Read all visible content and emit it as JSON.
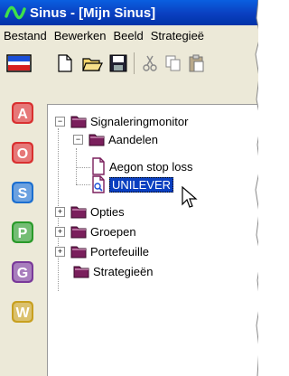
{
  "window": {
    "title": "Sinus - [Mijn Sinus]"
  },
  "menu": {
    "items": [
      "Bestand",
      "Bewerken",
      "Beeld",
      "Strategieë"
    ]
  },
  "toolbar": {
    "icons": [
      "layout-icon",
      "new-document-icon",
      "open-folder-icon",
      "save-icon",
      "cut-icon",
      "copy-icon",
      "paste-icon"
    ]
  },
  "sidebar": {
    "items": [
      {
        "letter": "A",
        "color": "#d93030"
      },
      {
        "letter": "O",
        "color": "#d93030"
      },
      {
        "letter": "S",
        "color": "#1c6fd0"
      },
      {
        "letter": "P",
        "color": "#2a9a2a"
      },
      {
        "letter": "G",
        "color": "#7a3a9a"
      },
      {
        "letter": "W",
        "color": "#c8a020"
      }
    ]
  },
  "tree": {
    "root": "Signaleringmonitor",
    "aandelen": "Aandelen",
    "aegon": "Aegon stop loss",
    "unilever": "UNILEVER",
    "opties": "Opties",
    "groepen": "Groepen",
    "portefeuille": "Portefeuille",
    "strategieen": "Strategieën"
  }
}
